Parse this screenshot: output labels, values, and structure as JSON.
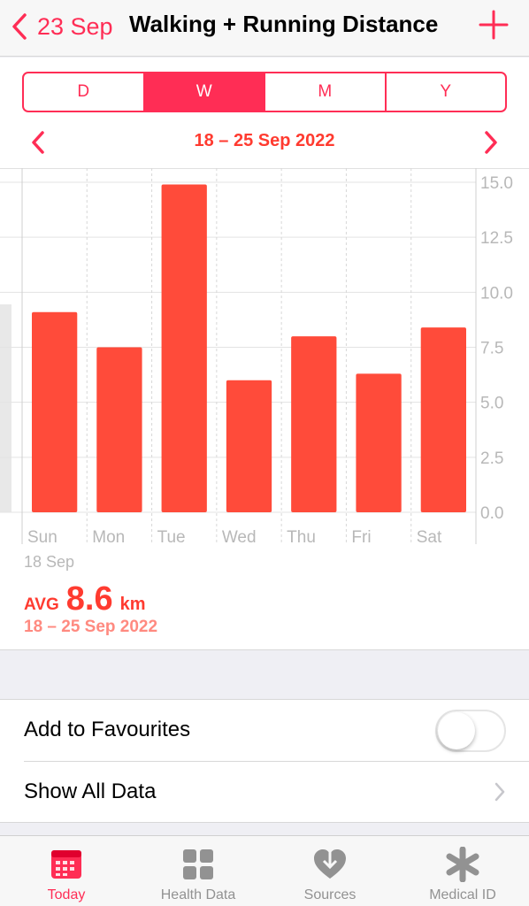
{
  "nav": {
    "back_label": "23 Sep",
    "title": "Walking + Running Distance"
  },
  "segments": [
    {
      "label": "D",
      "active": false
    },
    {
      "label": "W",
      "active": true
    },
    {
      "label": "M",
      "active": false
    },
    {
      "label": "Y",
      "active": false
    }
  ],
  "range_label": "18 – 25 Sep 2022",
  "chart_data": {
    "type": "bar",
    "categories": [
      "Sun",
      "Mon",
      "Tue",
      "Wed",
      "Thu",
      "Fri",
      "Sat"
    ],
    "values": [
      9.1,
      7.5,
      14.9,
      6.0,
      8.0,
      6.3,
      8.4
    ],
    "y_ticks": [
      "15.0",
      "12.5",
      "10.0",
      "7.5",
      "5.0",
      "2.5",
      "0.0"
    ],
    "ylim": [
      0,
      15
    ],
    "ylabel": "",
    "xlabel": "",
    "title": "",
    "color": "#ff4b3a",
    "grid": true
  },
  "summary": {
    "selected_date": "18 Sep",
    "avg_label": "AVG",
    "avg_value": "8.6",
    "avg_unit": "km",
    "range": "18 – 25 Sep 2022"
  },
  "settings": {
    "favourites_label": "Add to Favourites",
    "favourites_on": false,
    "show_all_label": "Show All Data"
  },
  "tabs": [
    {
      "label": "Today",
      "icon": "calendar-icon",
      "active": true
    },
    {
      "label": "Health Data",
      "icon": "grid-icon",
      "active": false
    },
    {
      "label": "Sources",
      "icon": "heart-download-icon",
      "active": false
    },
    {
      "label": "Medical ID",
      "icon": "asterisk-icon",
      "active": false
    }
  ],
  "colors": {
    "accent": "#ff2d55",
    "bar": "#ff4b3a",
    "inactive": "#929292"
  }
}
